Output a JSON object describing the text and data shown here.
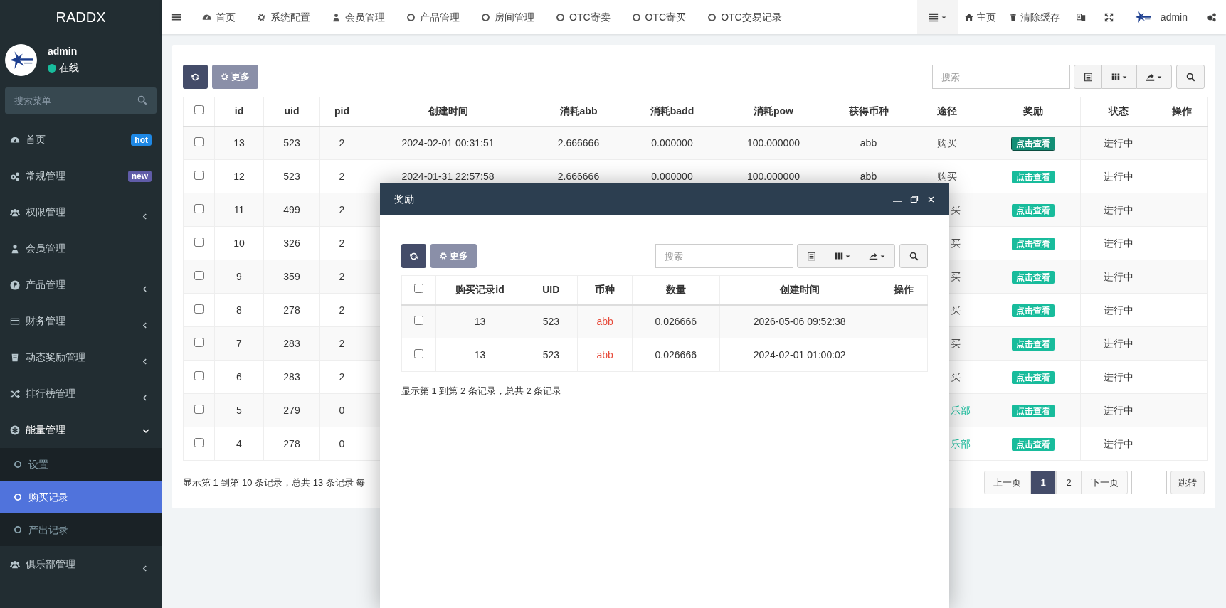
{
  "sidebar": {
    "brand": "RADDX",
    "user": {
      "name": "admin",
      "status": "在线"
    },
    "search": {
      "placeholder": "搜索菜单"
    },
    "items": [
      {
        "label": "首页",
        "badge": {
          "text": "hot",
          "color": "#1e88e5"
        }
      },
      {
        "label": "常规管理",
        "badge": {
          "text": "new",
          "color": "#605ca8"
        }
      },
      {
        "label": "权限管理",
        "expanded": false
      },
      {
        "label": "会员管理"
      },
      {
        "label": "产品管理",
        "expanded": false
      },
      {
        "label": "财务管理",
        "expanded": false
      },
      {
        "label": "动态奖励管理",
        "expanded": false
      },
      {
        "label": "排行榜管理",
        "expanded": false
      },
      {
        "label": "能量管理",
        "expanded": true,
        "children": [
          {
            "label": "设置",
            "selected": false
          },
          {
            "label": "购买记录",
            "selected": true
          },
          {
            "label": "产出记录",
            "selected": false
          }
        ]
      },
      {
        "label": "俱乐部管理",
        "expanded": false
      }
    ]
  },
  "top_nav": {
    "tabs": [
      "首页",
      "系统配置",
      "会员管理",
      "产品管理",
      "房间管理",
      "OTC寄卖",
      "OTC寄买",
      "OTC交易记录"
    ],
    "right": [
      "主页",
      "清除缓存"
    ],
    "user": "admin"
  },
  "toolbar": {
    "more": "更多",
    "search": {
      "placeholder": "搜索"
    }
  },
  "table": {
    "header_checked": false,
    "columns": [
      "id",
      "uid",
      "pid",
      "创建时间",
      "消耗abb",
      "消耗badd",
      "消耗pow",
      "获得币种",
      "途径",
      "奖励",
      "状态",
      "操作"
    ],
    "rows": [
      {
        "checked": false,
        "cells": [
          "13",
          "523",
          "2",
          "2024-02-01 00:31:51",
          "2.666666",
          "0.000000",
          "100.000000",
          "abb",
          "购买"
        ],
        "channel_link": false,
        "reward": "点击查看",
        "focused": true,
        "status": "进行中"
      },
      {
        "checked": false,
        "cells": [
          "12",
          "523",
          "2",
          "2024-01-31 22:57:58",
          "2.666666",
          "0.000000",
          "100.000000",
          "abb",
          "购买"
        ],
        "channel_link": false,
        "reward": "点击查看",
        "focused": false,
        "status": "进行中"
      },
      {
        "checked": false,
        "cells": [
          "11",
          "499",
          "2"
        ],
        "channel": "买",
        "channel_link": false,
        "reward": "点击查看",
        "focused": false,
        "status": "进行中"
      },
      {
        "checked": false,
        "cells": [
          "10",
          "326",
          "2"
        ],
        "channel": "买",
        "channel_link": false,
        "reward": "点击查看",
        "focused": false,
        "status": "进行中"
      },
      {
        "checked": false,
        "cells": [
          "9",
          "359",
          "2"
        ],
        "channel": "买",
        "channel_link": false,
        "reward": "点击查看",
        "focused": false,
        "status": "进行中"
      },
      {
        "checked": false,
        "cells": [
          "8",
          "278",
          "2"
        ],
        "channel": "买",
        "channel_link": false,
        "reward": "点击查看",
        "focused": false,
        "status": "进行中"
      },
      {
        "checked": false,
        "cells": [
          "7",
          "283",
          "2"
        ],
        "channel": "买",
        "channel_link": false,
        "reward": "点击查看",
        "focused": false,
        "status": "进行中"
      },
      {
        "checked": false,
        "cells": [
          "6",
          "283",
          "2"
        ],
        "channel": "买",
        "channel_link": false,
        "reward": "点击查看",
        "focused": false,
        "status": "进行中"
      },
      {
        "checked": false,
        "cells": [
          "5",
          "279",
          "0"
        ],
        "channel": "乐部",
        "channel_link": true,
        "reward": "点击查看",
        "focused": false,
        "status": "进行中"
      },
      {
        "checked": false,
        "cells": [
          "4",
          "278",
          "0"
        ],
        "channel": "乐部",
        "channel_link": true,
        "reward": "点击查看",
        "focused": false,
        "status": "进行中"
      }
    ]
  },
  "summary": "显示第 1 到第 10 条记录，总共 13 条记录 每",
  "pagination": {
    "prev": "上一页",
    "pages": [
      {
        "label": "1",
        "selected": true
      },
      {
        "label": "2",
        "selected": false
      }
    ],
    "next": "下一页",
    "jump": "跳转"
  },
  "modal": {
    "title": "奖励",
    "toolbar": {
      "more": "更多",
      "search": {
        "placeholder": "搜索"
      }
    },
    "table": {
      "header_checked": false,
      "columns": [
        "购买记录id",
        "UID",
        "币种",
        "数量",
        "创建时间",
        "操作"
      ],
      "rows": [
        {
          "checked": false,
          "cells": [
            "13",
            "523",
            "abb",
            "0.026666",
            "2026-05-06 09:52:38"
          ]
        },
        {
          "checked": false,
          "cells": [
            "13",
            "523",
            "abb",
            "0.026666",
            "2024-02-01 01:00:02"
          ]
        }
      ]
    },
    "summary": "显示第 1 到第 2 条记录，总共 2 条记录"
  }
}
